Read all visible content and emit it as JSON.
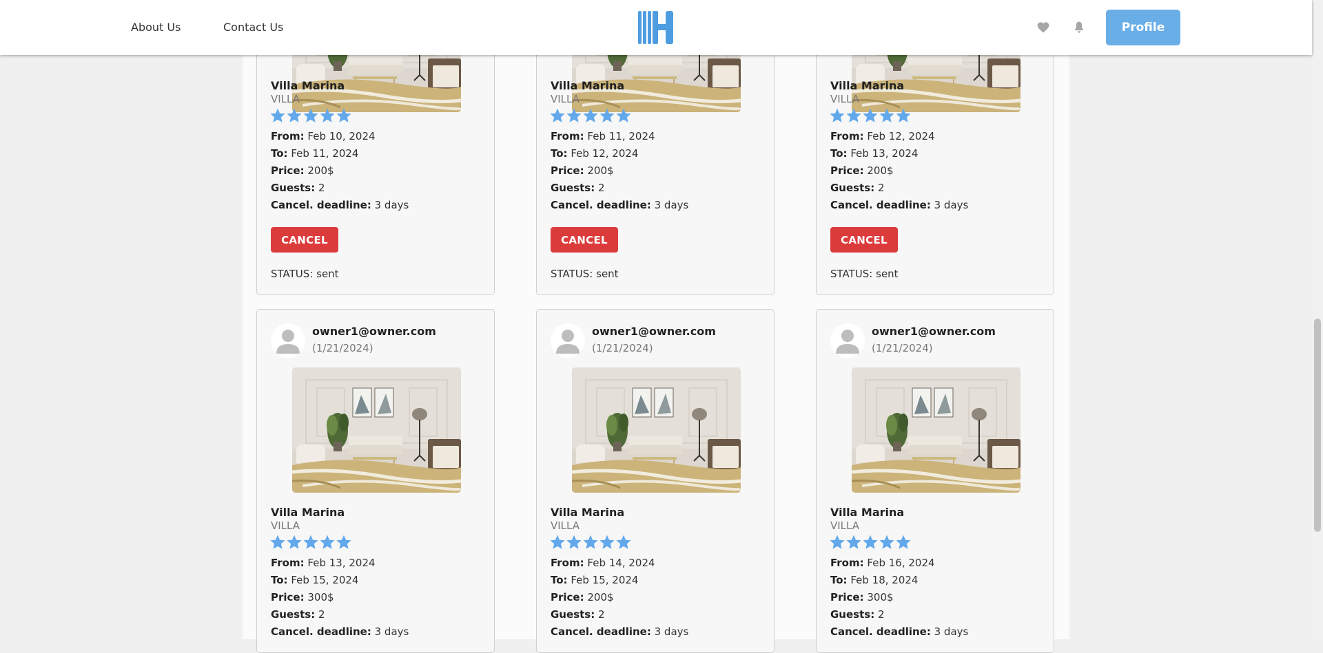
{
  "nav": {
    "about": "About Us",
    "contact": "Contact Us",
    "profile": "Profile"
  },
  "colors": {
    "accent": "#6aaee8",
    "cancel": "#dc3b3b",
    "star": "#62a8eb"
  },
  "labels": {
    "from": "From:",
    "to": "To:",
    "price": "Price:",
    "guests": "Guests:",
    "deadline": "Cancel. deadline:",
    "cancel": "CANCEL",
    "status": "STATUS:"
  },
  "topRow": [
    {
      "villa": "Villa Marina",
      "type": "VILLA",
      "rating": 5,
      "from": "Feb 10, 2024",
      "to": "Feb 11, 2024",
      "price": "200$",
      "guests": "2",
      "deadline": "3 days",
      "status": "sent"
    },
    {
      "villa": "Villa Marina",
      "type": "VILLA",
      "rating": 5,
      "from": "Feb 11, 2024",
      "to": "Feb 12, 2024",
      "price": "200$",
      "guests": "2",
      "deadline": "3 days",
      "status": "sent"
    },
    {
      "villa": "Villa Marina",
      "type": "VILLA",
      "rating": 5,
      "from": "Feb 12, 2024",
      "to": "Feb 13, 2024",
      "price": "200$",
      "guests": "2",
      "deadline": "3 days",
      "status": "sent"
    }
  ],
  "bottomRow": [
    {
      "owner": "owner1@owner.com",
      "date": "(1/21/2024)",
      "villa": "Villa Marina",
      "type": "VILLA",
      "rating": 5,
      "from": "Feb 13, 2024",
      "to": "Feb 15, 2024",
      "price": "300$",
      "guests": "2",
      "deadline": "3 days"
    },
    {
      "owner": "owner1@owner.com",
      "date": "(1/21/2024)",
      "villa": "Villa Marina",
      "type": "VILLA",
      "rating": 5,
      "from": "Feb 14, 2024",
      "to": "Feb 15, 2024",
      "price": "200$",
      "guests": "2",
      "deadline": "3 days"
    },
    {
      "owner": "owner1@owner.com",
      "date": "(1/21/2024)",
      "villa": "Villa Marina",
      "type": "VILLA",
      "rating": 5,
      "from": "Feb 16, 2024",
      "to": "Feb 18, 2024",
      "price": "300$",
      "guests": "2",
      "deadline": "3 days"
    }
  ]
}
